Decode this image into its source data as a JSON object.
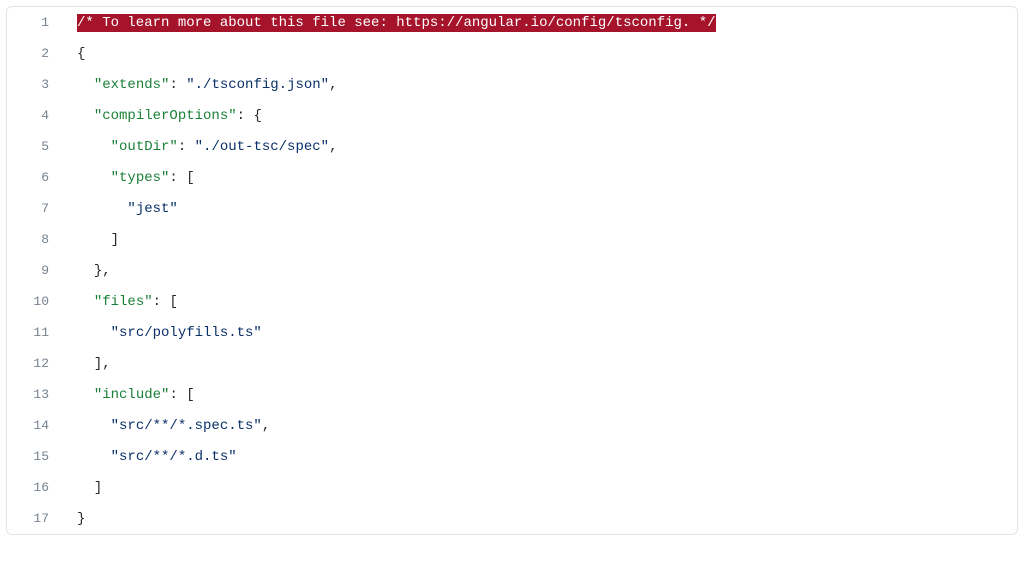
{
  "lines": {
    "1": {
      "num": "1"
    },
    "2": {
      "num": "2"
    },
    "3": {
      "num": "3"
    },
    "4": {
      "num": "4"
    },
    "5": {
      "num": "5"
    },
    "6": {
      "num": "6"
    },
    "7": {
      "num": "7"
    },
    "8": {
      "num": "8"
    },
    "9": {
      "num": "9"
    },
    "10": {
      "num": "10"
    },
    "11": {
      "num": "11"
    },
    "12": {
      "num": "12"
    },
    "13": {
      "num": "13"
    },
    "14": {
      "num": "14"
    },
    "15": {
      "num": "15"
    },
    "16": {
      "num": "16"
    },
    "17": {
      "num": "17"
    }
  },
  "tokens": {
    "comment": "/* To learn more about this file see: https://angular.io/config/tsconfig. */",
    "brace_open": "{",
    "brace_close": "}",
    "bracket_open": "[",
    "bracket_close": "]",
    "extends_key": "\"extends\"",
    "extends_val": "\"./tsconfig.json\"",
    "colon_space": ": ",
    "comma": ",",
    "compilerOptions_key": "\"compilerOptions\"",
    "outDir_key": "\"outDir\"",
    "outDir_val": "\"./out-tsc/spec\"",
    "types_key": "\"types\"",
    "jest_val": "\"jest\"",
    "files_key": "\"files\"",
    "polyfills_val": "\"src/polyfills.ts\"",
    "include_key": "\"include\"",
    "spec_glob": "\"src/**/*.spec.ts\"",
    "dts_glob": "\"src/**/*.d.ts\""
  }
}
